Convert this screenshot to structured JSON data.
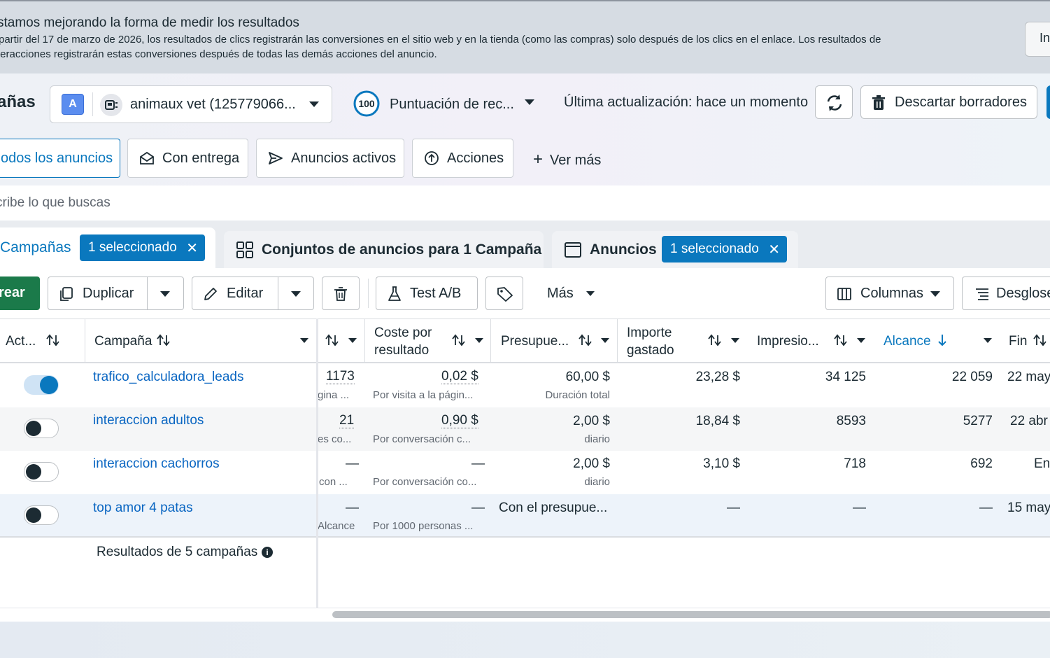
{
  "banner": {
    "title": "stamos mejorando la forma de medir los resultados",
    "line1": "partir del 17 de marzo de 2026, los resultados de clics registrarán las conversiones en el sitio web y en la tienda (como las compras) solo después de los clics en el enlace. Los resultados de",
    "line2": "teracciones registrarán estas conversiones después de todas las demás acciones del anuncio.",
    "button_label": "In"
  },
  "header": {
    "title": "añas",
    "account_badge": "A",
    "account_name": "animaux vet (125779066...",
    "score_value": "100",
    "score_label": "Puntuación de rec...",
    "last_update": "Última actualización: hace un momento",
    "discard_label": "Descartar borradores"
  },
  "filters": {
    "all": "odos los anuncios",
    "delivery": "Con entrega",
    "active": "Anuncios activos",
    "actions": "Acciones",
    "more": "Ver más"
  },
  "search": {
    "placeholder": "cribe lo que buscas"
  },
  "level_tabs": {
    "campaigns": {
      "label": "Campañas",
      "pill": "1 seleccionado"
    },
    "adsets": {
      "label": "Conjuntos de anuncios para 1 Campaña"
    },
    "ads": {
      "label": "Anuncios",
      "pill": "1 seleccionado"
    }
  },
  "toolbar": {
    "create": "rear",
    "duplicate": "Duplicar",
    "edit": "Editar",
    "ab_test": "Test A/B",
    "more": "Más",
    "columns": "Columnas",
    "breakdown": "Desglose"
  },
  "table": {
    "headers": {
      "active": "Act...",
      "campaign": "Campaña",
      "cost_l1": "Coste por",
      "cost_l2": "resultado",
      "budget": "Presupue...",
      "spent_l1": "Importe",
      "spent_l2": "gastado",
      "impressions": "Impresio...",
      "reach": "Alcance",
      "end": "Fin"
    },
    "rows": [
      {
        "active": true,
        "name": "trafico_calculadora_leads",
        "results": "1173",
        "results_sub": "gina ...",
        "cost": "0,02 $",
        "cost_sub": "Por visita a la págin...",
        "budget": "60,00 $",
        "budget_sub": "Duración total",
        "spent": "23,28 $",
        "impressions": "34 125",
        "reach": "22 059",
        "end": "22 may"
      },
      {
        "active": false,
        "name": "interaccion adultos",
        "results": "21",
        "results_sub": "es co...",
        "cost": "0,90 $",
        "cost_sub": "Por conversación c...",
        "budget": "2,00 $",
        "budget_sub": "diario",
        "spent": "18,84 $",
        "impressions": "8593",
        "reach": "5277",
        "end": "22 abr"
      },
      {
        "active": false,
        "name": "interaccion cachorros",
        "results": "—",
        "results_sub": "con ...",
        "cost": "—",
        "cost_sub": "Por conversación co...",
        "budget": "2,00 $",
        "budget_sub": "diario",
        "spent": "3,10 $",
        "impressions": "718",
        "reach": "692",
        "end": "En"
      },
      {
        "active": false,
        "name": "top amor 4 patas",
        "results": "—",
        "results_sub": "Alcance",
        "cost": "—",
        "cost_sub": "Por 1000 personas ...",
        "budget": "Con el presupue...",
        "budget_sub": "",
        "spent": "—",
        "impressions": "—",
        "reach": "—",
        "end": "15 may"
      }
    ],
    "footer": "Resultados de 5 campañas"
  },
  "colors": {
    "accent": "#0a78be",
    "create_green": "#1b7a4a",
    "link": "#0a66c2",
    "banner_bg": "#d6dce3"
  }
}
